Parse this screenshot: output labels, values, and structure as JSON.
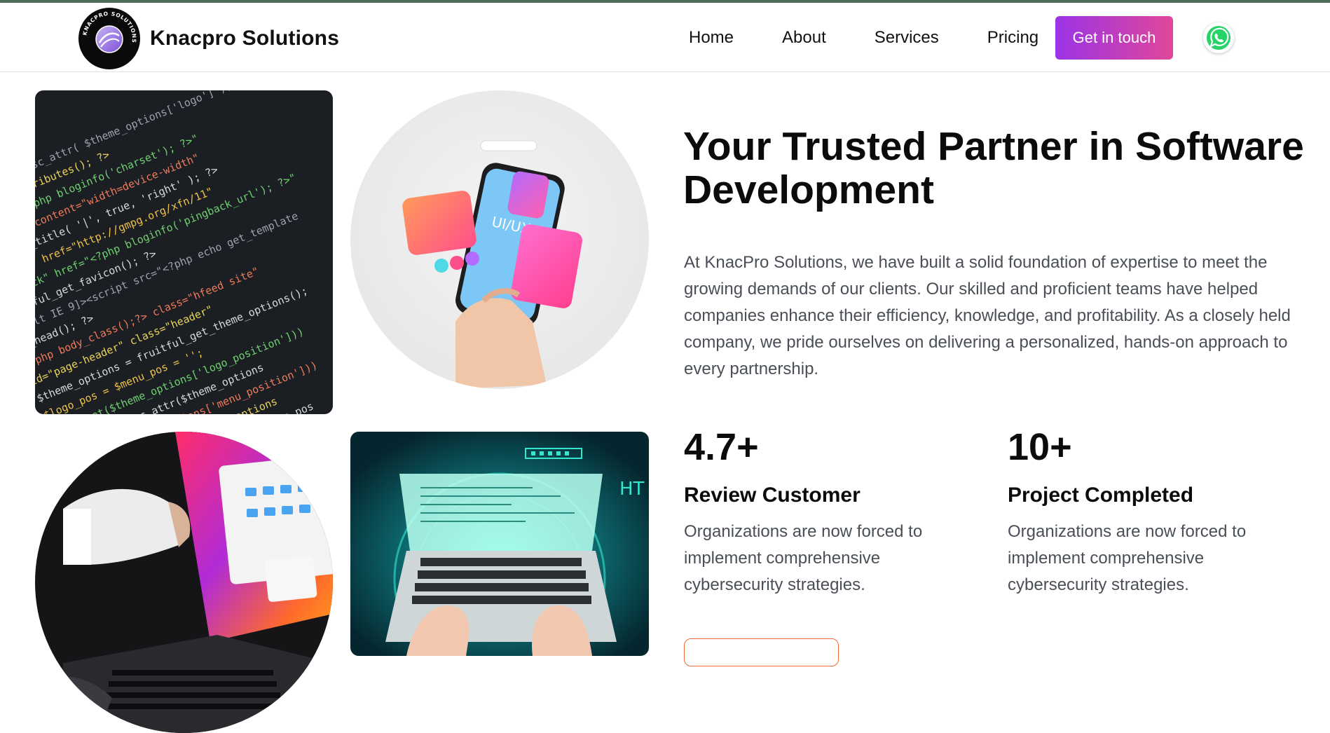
{
  "header": {
    "brand_name": "Knacpro Solutions",
    "logo_ring_text": "KNACPRO SOLUTIONS",
    "nav": [
      "Home",
      "About",
      "Services",
      "Pricing"
    ],
    "cta_label": "Get in touch",
    "whatsapp_icon": "whatsapp-icon",
    "cta_gradient": [
      "#9b33e6",
      "#e0479a"
    ]
  },
  "images": {
    "code_photo_icon": "code-screen-photo",
    "uiux_photo_label": "UI/UX",
    "laptop_photo_icon": "laptop-photo",
    "typing_photo_label": "HT"
  },
  "hero": {
    "title": "Your Trusted Partner in Software Development",
    "intro": "At KnacPro Solutions, we have built a solid foundation of expertise to meet the growing demands of our clients. Our skilled and proficient teams have helped companies enhance their efficiency, knowledge, and profitability. As a closely held company, we pride ourselves on delivering a personalized, hands-on approach to every partnership."
  },
  "stats": [
    {
      "number": "4.7+",
      "title": "Review Customer",
      "description": "Organizations are now forced to implement comprehensive cybersecurity strategies."
    },
    {
      "number": "10+",
      "title": "Project Completed",
      "description": "Organizations are now forced to implement comprehensive cybersecurity strategies."
    }
  ],
  "colors": {
    "accent_orange": "#ef6a3a",
    "text_dark": "#0b0b0b",
    "text_body": "#4a4f57"
  }
}
